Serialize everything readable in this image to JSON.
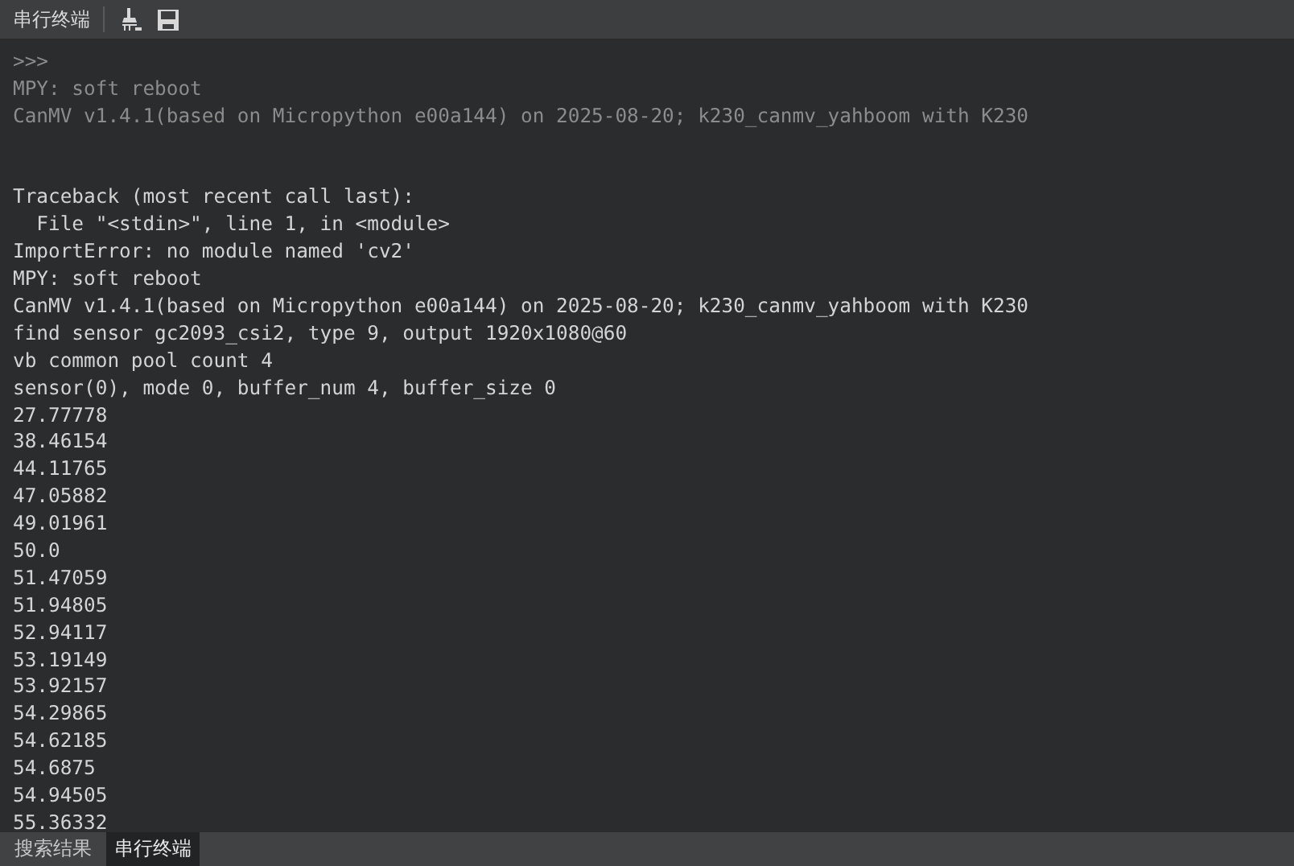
{
  "panel": {
    "title": "串行终端"
  },
  "lines": [
    {
      "kind": "text",
      "text": ">>>",
      "dimmed": true
    },
    {
      "kind": "text",
      "text": "MPY: soft reboot",
      "dimmed": true
    },
    {
      "kind": "text",
      "text": "CanMV v1.4.1(based on Micropython e00a144) on 2025-08-20; k230_canmv_yahboom with K230",
      "dimmed": true
    },
    {
      "kind": "blank"
    },
    {
      "kind": "blank"
    },
    {
      "kind": "text",
      "text": "Traceback (most recent call last):",
      "dimmed": false
    },
    {
      "kind": "text",
      "text": "  File \"<stdin>\", line 1, in <module>",
      "dimmed": false
    },
    {
      "kind": "text",
      "text": "ImportError: no module named 'cv2'",
      "dimmed": false
    },
    {
      "kind": "text",
      "text": "MPY: soft reboot",
      "dimmed": false
    },
    {
      "kind": "text",
      "text": "CanMV v1.4.1(based on Micropython e00a144) on 2025-08-20; k230_canmv_yahboom with K230",
      "dimmed": false
    },
    {
      "kind": "text",
      "text": "find sensor gc2093_csi2, type 9, output 1920x1080@60",
      "dimmed": false
    },
    {
      "kind": "text",
      "text": "vb common pool count 4",
      "dimmed": false
    },
    {
      "kind": "text",
      "text": "sensor(0), mode 0, buffer_num 4, buffer_size 0",
      "dimmed": false
    },
    {
      "kind": "text",
      "text": "27.77778",
      "dimmed": false
    },
    {
      "kind": "text",
      "text": "38.46154",
      "dimmed": false
    },
    {
      "kind": "text",
      "text": "44.11765",
      "dimmed": false
    },
    {
      "kind": "text",
      "text": "47.05882",
      "dimmed": false
    },
    {
      "kind": "text",
      "text": "49.01961",
      "dimmed": false
    },
    {
      "kind": "text",
      "text": "50.0",
      "dimmed": false
    },
    {
      "kind": "text",
      "text": "51.47059",
      "dimmed": false
    },
    {
      "kind": "text",
      "text": "51.94805",
      "dimmed": false
    },
    {
      "kind": "text",
      "text": "52.94117",
      "dimmed": false
    },
    {
      "kind": "text",
      "text": "53.19149",
      "dimmed": false
    },
    {
      "kind": "text",
      "text": "53.92157",
      "dimmed": false
    },
    {
      "kind": "text",
      "text": "54.29865",
      "dimmed": false
    },
    {
      "kind": "text",
      "text": "54.62185",
      "dimmed": false
    },
    {
      "kind": "text",
      "text": "54.6875",
      "dimmed": false
    },
    {
      "kind": "text",
      "text": "54.94505",
      "dimmed": false
    },
    {
      "kind": "text",
      "text": "55.36332",
      "dimmed": false
    }
  ],
  "bottom_tabs": [
    {
      "label": "搜索结果",
      "selected": false
    },
    {
      "label": "串行终端",
      "selected": true
    }
  ]
}
